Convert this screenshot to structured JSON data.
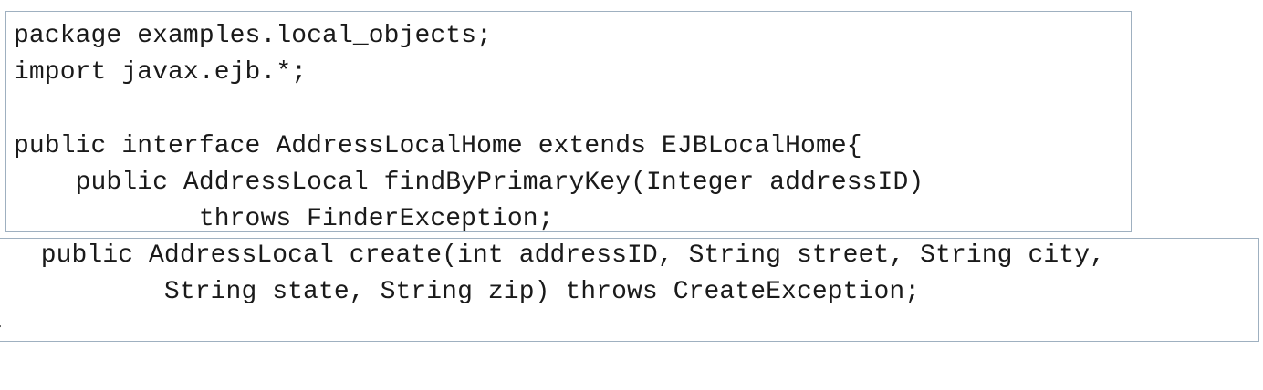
{
  "code_blocks": [
    {
      "lines": [
        "package examples.local_objects;",
        "import javax.ejb.*;",
        "",
        "public interface AddressLocalHome extends EJBLocalHome{",
        "    public AddressLocal findByPrimaryKey(Integer addressID)",
        "            throws FinderException;"
      ]
    },
    {
      "lines": [
        "   public AddressLocal create(int addressID, String street, String city,",
        "           String state, String zip) throws CreateException;",
        "}"
      ]
    }
  ]
}
